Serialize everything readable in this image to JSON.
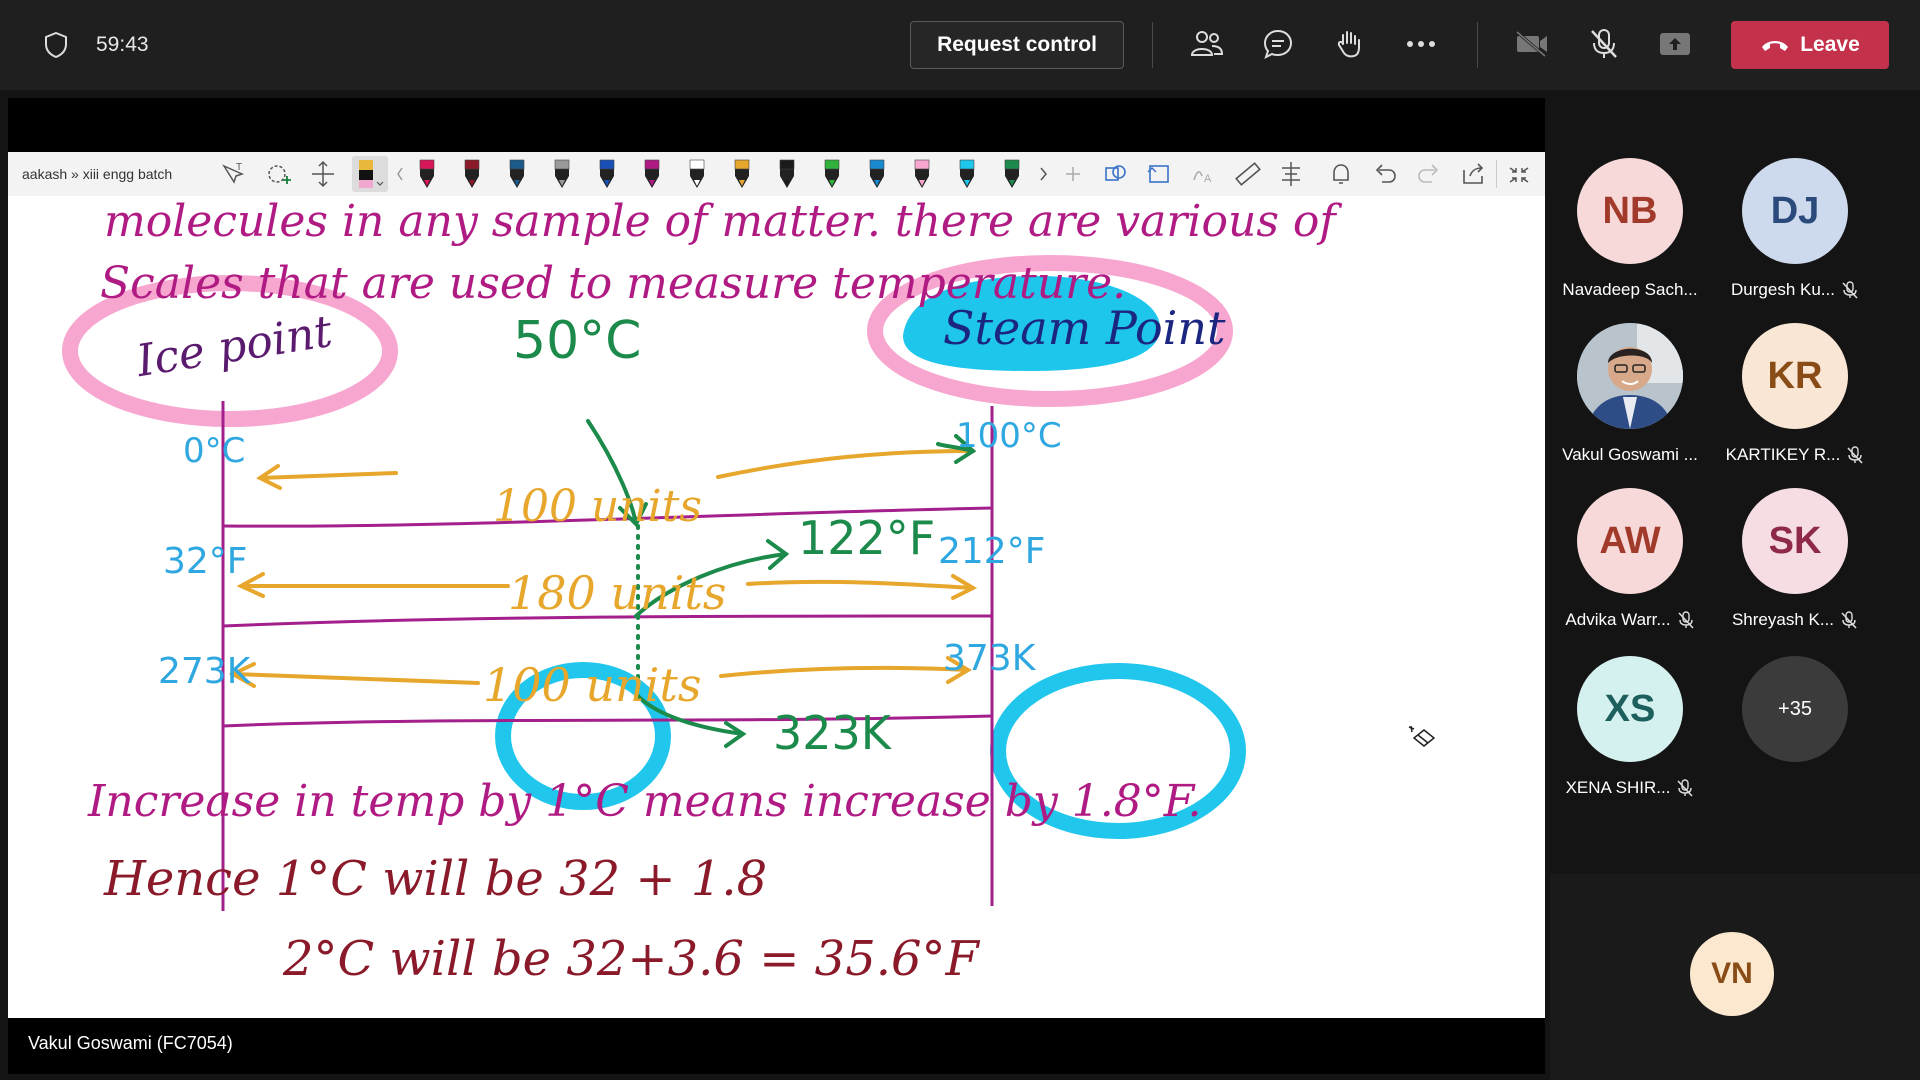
{
  "topbar": {
    "timer": "59:43",
    "request_control": "Request control",
    "leave": "Leave",
    "icons": [
      "shield-icon",
      "people-icon",
      "chat-icon",
      "raise-hand-icon",
      "more-icon",
      "camera-off-icon",
      "mic-off-icon",
      "share-tray-icon",
      "phone-hangup-icon"
    ]
  },
  "share": {
    "breadcrumb": "aakash » xiii engg batch",
    "presenter": "Vakul Goswami (FC7054)"
  },
  "board": {
    "line1": "molecules in any sample of matter. there are various of",
    "line2": "Scales that are used to measure temperature.",
    "ice_point": "Ice point",
    "steam_point": "Steam Point",
    "c50": "50°C",
    "c0": "0°C",
    "c100": "100°C",
    "f32": "32°F",
    "f212": "212°F",
    "k273": "273K",
    "k373": "373K",
    "u100": "100 units",
    "u180": "180 units",
    "u100b": "100 units",
    "f122": "122°F",
    "k323": "323K",
    "inc": "Increase in temp by 1°C means increase by 1.8°F.",
    "hence": "Hence   1°C will   be   32 + 1.8",
    "two": "2°C   will   be   32+3.6  =  35.6°F"
  },
  "participants": [
    {
      "initials": "NB",
      "name": "Navadeep Sach...",
      "muted": false,
      "bg": "#f7d9d9",
      "fg": "#a13a2a"
    },
    {
      "initials": "DJ",
      "name": "Durgesh Ku...",
      "muted": true,
      "bg": "#cdd9ec",
      "fg": "#2b4a7c"
    },
    {
      "initials": "",
      "name": "Vakul Goswami ...",
      "muted": false,
      "bg": "#8a8a8a",
      "fg": "#fff"
    },
    {
      "initials": "KR",
      "name": "KARTIKEY R...",
      "muted": true,
      "bg": "#fae6d4",
      "fg": "#8a4c16"
    },
    {
      "initials": "AW",
      "name": "Advika Warr...",
      "muted": true,
      "bg": "#f7d9d9",
      "fg": "#a13a2a"
    },
    {
      "initials": "SK",
      "name": "Shreyash K...",
      "muted": true,
      "bg": "#f5dde3",
      "fg": "#8e2a48"
    },
    {
      "initials": "XS",
      "name": "XENA SHIR...",
      "muted": true,
      "bg": "#d4f0ef",
      "fg": "#1d5f5c"
    },
    {
      "initials": "+35",
      "name": "",
      "muted": false,
      "bg": "#3b3b3b",
      "fg": "#fff"
    }
  ],
  "self": {
    "initials": "VN",
    "bg": "#fce8cf",
    "fg": "#8a4c16"
  }
}
